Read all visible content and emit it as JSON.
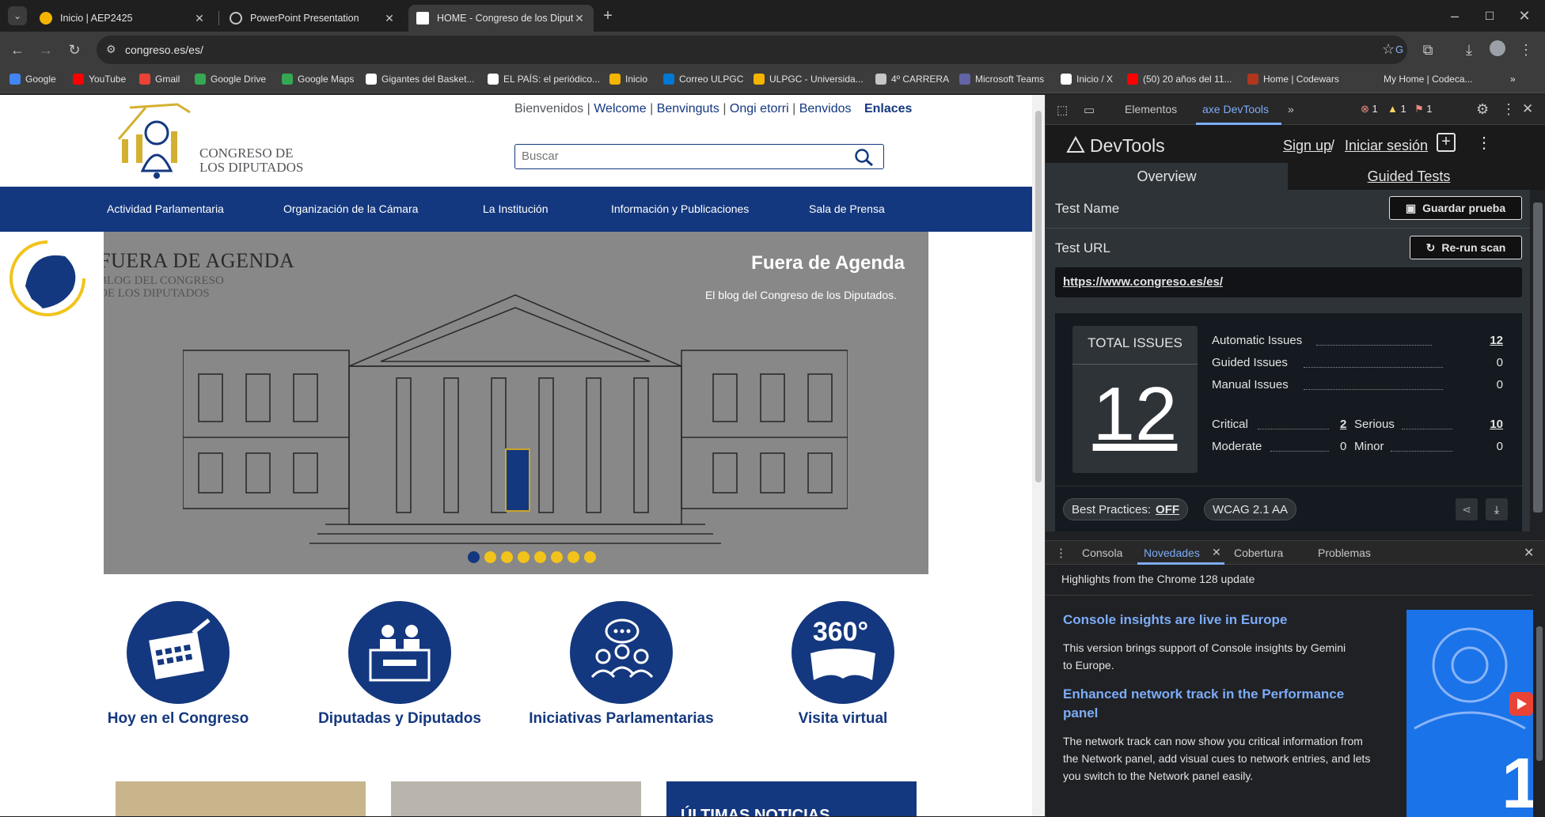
{
  "browser": {
    "tabs": [
      {
        "title": "Inicio | AEP2425",
        "active": false
      },
      {
        "title": "PowerPoint Presentation",
        "active": false
      },
      {
        "title": "HOME - Congreso de los Diputados",
        "active": true
      }
    ],
    "new_tab_label": "+",
    "address": "congreso.es/es/",
    "bookmarks": [
      {
        "label": "Google",
        "color": "#4285f4"
      },
      {
        "label": "YouTube",
        "color": "#ff0000"
      },
      {
        "label": "Gmail",
        "color": "#ea4335"
      },
      {
        "label": "Google Drive",
        "color": "#34a853"
      },
      {
        "label": "Google Maps",
        "color": "#34a853"
      },
      {
        "label": "Gigantes del Basket...",
        "color": "#ffffff"
      },
      {
        "label": "EL PAÍS: el periódico...",
        "color": "#ffffff"
      },
      {
        "label": "Inicio",
        "color": "#f4b400"
      },
      {
        "label": "Correo ULPGC",
        "color": "#0078d4"
      },
      {
        "label": "ULPGC - Universida...",
        "color": "#f4b400"
      },
      {
        "label": "4º CARRERA",
        "color": "#c4c7c5"
      },
      {
        "label": "Microsoft Teams",
        "color": "#6264a7"
      },
      {
        "label": "Inicio / X",
        "color": "#ffffff"
      },
      {
        "label": "(50) 20 años del 11...",
        "color": "#ff0000"
      },
      {
        "label": "Home | Codewars",
        "color": "#b1361e"
      },
      {
        "label": "My Home | Codeca...",
        "color": "#3c3c3c"
      }
    ]
  },
  "site": {
    "logo_line1": "CONGRESO DE",
    "logo_line2": "LOS DIPUTADOS",
    "toplinks": {
      "bienvenidos": "Bienvenidos",
      "welcome": "Welcome",
      "benvinguts": "Benvinguts",
      "ongi": "Ongi etorri",
      "benvidos": "Benvidos",
      "enlaces": "Enlaces",
      "sep": "|"
    },
    "search_placeholder": "Buscar",
    "nav": [
      "Actividad Parlamentaria",
      "Organización de la Cámara",
      "La Institución",
      "Información y Publicaciones",
      "Sala de Prensa"
    ],
    "hero": {
      "logo_title": "FUERA DE AGENDA",
      "logo_sub1": "BLOG DEL CONGRESO",
      "logo_sub2": "DE LOS DIPUTADOS",
      "heading": "Fuera de Agenda",
      "sub": "El blog del Congreso de los Diputados.",
      "slides": 8,
      "current_slide": 1
    },
    "quicklinks": [
      {
        "label": "Hoy en el Congreso",
        "icon": "calendar-icon"
      },
      {
        "label": "Diputadas y Diputados",
        "icon": "deputies-icon"
      },
      {
        "label": "Iniciativas Parlamentarias",
        "icon": "initiatives-icon"
      },
      {
        "label": "Visita virtual",
        "icon": "vr-360-icon"
      }
    ],
    "news_heading": "ÚLTIMAS NOTICIAS"
  },
  "devtools": {
    "tabs": [
      "Elementos",
      "axe DevTools"
    ],
    "errors": "1",
    "warnings": "1",
    "issues": "1",
    "axe": {
      "brand": "DevTools",
      "sign_up": "Sign up",
      "slash": "/",
      "sign_in": "Iniciar sesión",
      "tab_overview": "Overview",
      "tab_guided": "Guided Tests",
      "test_name_label": "Test Name",
      "save_label": "Guardar prueba",
      "test_url_label": "Test URL",
      "rerun_label": "Re-run scan",
      "test_url": "https://www.congreso.es/es/",
      "total_label": "TOTAL ISSUES",
      "total": "12",
      "automatic_label": "Automatic Issues",
      "automatic": "12",
      "guided_label": "Guided Issues",
      "guided": "0",
      "manual_label": "Manual Issues",
      "manual": "0",
      "critical_label": "Critical",
      "critical": "2",
      "serious_label": "Serious",
      "serious": "10",
      "moderate_label": "Moderate",
      "moderate": "0",
      "minor_label": "Minor",
      "minor": "0",
      "best_practices_label": "Best Practices:",
      "best_practices_value": "OFF",
      "wcag": "WCAG 2.1 AA"
    },
    "drawer": {
      "tabs": [
        "Consola",
        "Novedades",
        "Cobertura",
        "Problemas"
      ],
      "active_tab": "Novedades",
      "header": "Highlights from the Chrome 128 update",
      "items": [
        {
          "title": "Console insights are live in Europe",
          "body": "This version brings support of Console insights by Gemini to Europe."
        },
        {
          "title": "Enhanced network track in the Performance panel",
          "body": "The network track can now show you critical information from the Network panel, add visual cues to network entries, and lets you switch to the Network panel easily."
        }
      ]
    }
  }
}
